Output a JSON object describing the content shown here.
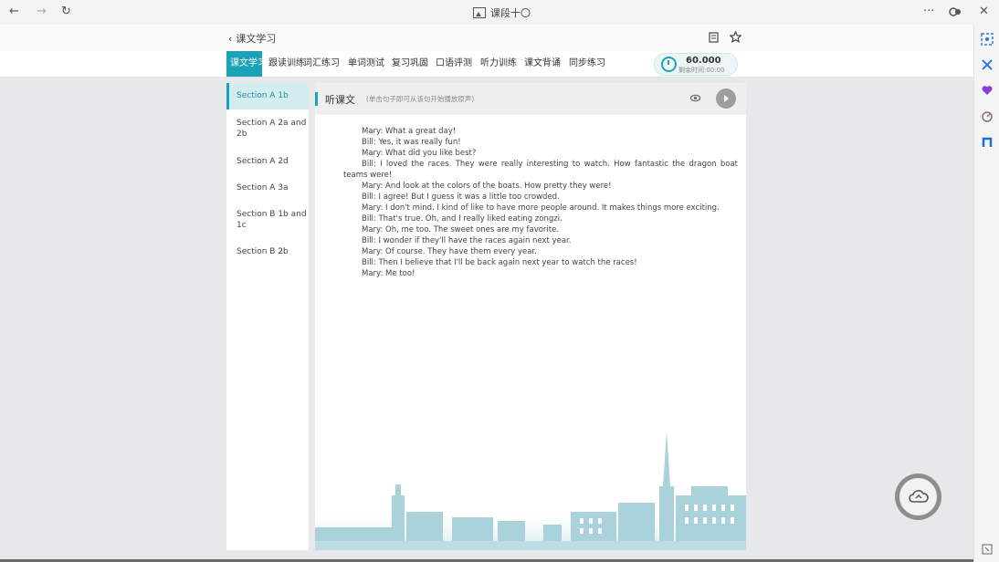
{
  "window": {
    "title": "课段十〇",
    "controls": {
      "back": "←",
      "forward": "→",
      "refresh": "↻",
      "more": "···",
      "close": "✕"
    }
  },
  "header": {
    "back_label": "课文学习"
  },
  "tabs": [
    {
      "label": "课文学习",
      "active": true
    },
    {
      "label": "跟读训练"
    },
    {
      "label": "词汇练习"
    },
    {
      "label": "单词测试"
    },
    {
      "label": "复习巩固"
    },
    {
      "label": "口语评测"
    },
    {
      "label": "听力训练"
    },
    {
      "label": "课文背诵"
    },
    {
      "label": "同步练习"
    }
  ],
  "score": {
    "value": "60.000",
    "sub": "剩余时间:00:00"
  },
  "sidebar": {
    "items": [
      {
        "label": "Section A 1b",
        "active": true
      },
      {
        "label": "Section A 2a and 2b"
      },
      {
        "label": "Section A 2d"
      },
      {
        "label": "Section A 3a"
      },
      {
        "label": "Section B 1b and 1c"
      },
      {
        "label": "Section B 2b"
      }
    ]
  },
  "panel": {
    "title": "听课文",
    "hint": "(单击句子即可从该句开始播放原声)",
    "dialog": [
      "Mary: What a great day!",
      "Bill: Yes, it was really fun!",
      "Mary: What did you like best?",
      "Bill: I loved the races. They were really interesting to watch. How fantastic the dragon boat teams were!",
      "Mary: And look at the colors of the boats. How pretty they were!",
      "Bill: I agree! But I guess it was a little too crowded.",
      "Mary: I don't mind. I kind of like to have more people around. It makes things more exciting.",
      "Bill: That's true. Oh, and I really liked eating zongzi.",
      "Mary: Oh, me too. The sweet ones are my favorite.",
      "Bill: I wonder if they'll have the races again next year.",
      "Mary: Of course. They have them every year.",
      "Bill: Then I believe that I'll be back again next year to watch the races!",
      "Mary: Me too!"
    ]
  },
  "colors": {
    "accent": "#1aa3b8",
    "background": "#e7e8ea"
  },
  "icons": [
    "document-icon",
    "star-icon",
    "eye-icon",
    "play-icon",
    "cloud-icon",
    "clock-icon"
  ]
}
